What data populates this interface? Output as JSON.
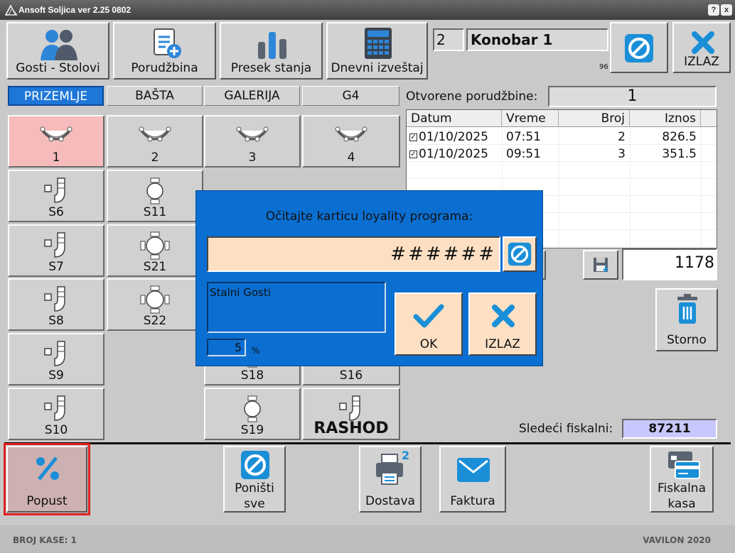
{
  "window": {
    "title": "Ansoft Soljica ver 2.25 0802",
    "help_label": "?",
    "close_label": "x"
  },
  "toolbar": {
    "guests_tables": "Gosti - Stolovi",
    "order": "Porudžbina",
    "state_cut": "Presek stanja",
    "daily_report": "Dnevni izveštaj"
  },
  "waiter": {
    "id": "2",
    "name": "Konobar 1",
    "small_number": "96"
  },
  "exit_label": "IZLAZ",
  "tabs": [
    "PRIZEMLJE",
    "BAŠTA",
    "GALERIJA",
    "G4"
  ],
  "tables": [
    {
      "label": "1",
      "icon": "round-table-icon",
      "selected": true
    },
    {
      "label": "2",
      "icon": "round-table-icon"
    },
    {
      "label": "3",
      "icon": "round-table-icon"
    },
    {
      "label": "4",
      "icon": "round-table-icon"
    },
    {
      "label": "S6",
      "icon": "bar-seat-icon"
    },
    {
      "label": "S11",
      "icon": "two-seat-table-icon"
    },
    {
      "label": "S7",
      "icon": "bar-seat-icon"
    },
    {
      "label": "S21",
      "icon": "four-seat-table-icon"
    },
    {
      "label": "S8",
      "icon": "bar-seat-icon"
    },
    {
      "label": "S22",
      "icon": "four-seat-table-icon"
    },
    {
      "label": "S9",
      "icon": "bar-seat-icon"
    },
    {
      "label": "S18",
      "icon": "two-seat-table-icon"
    },
    {
      "label": "S16",
      "icon": "bar-seat-icon"
    },
    {
      "label": "S10",
      "icon": "bar-seat-icon"
    },
    {
      "label": "S19",
      "icon": "two-seat-table-icon"
    },
    {
      "label": "RASHOD",
      "icon": "bar-seat-icon"
    }
  ],
  "orders": {
    "label": "Otvorene porudžbine:",
    "count": "1",
    "headers": [
      "Datum",
      "Vreme",
      "Broj",
      "Iznos"
    ],
    "rows": [
      {
        "date": "01/10/2025",
        "time": "07:51",
        "num": "2",
        "amount": "826.5"
      },
      {
        "date": "01/10/2025",
        "time": "09:51",
        "num": "3",
        "amount": "351.5"
      }
    ],
    "total": "1178"
  },
  "storno_label": "Storno",
  "fiscal": {
    "label": "Sledeći fiskalni:",
    "value": "87211"
  },
  "bottom_buttons": {
    "discount": "Popust",
    "cancel_all_1": "Poništi",
    "cancel_all_2": "sve",
    "delivery": "Dostava",
    "invoice": "Faktura",
    "fiscal_1": "Fiskalna",
    "fiscal_2": "kasa",
    "printer_badge": "2"
  },
  "dialog": {
    "title": "Očitajte karticu loyality programa:",
    "input_value": "######",
    "list_text": "Stalni Gosti",
    "percent_value": "5",
    "percent_label": "%",
    "ok_label": "OK",
    "exit_label": "IZLAZ"
  },
  "statusbar": {
    "left": "BROJ KASE: 1",
    "right": "VAVILON 2020"
  },
  "colors": {
    "accent_blue": "#1e77d8",
    "dialog_bg": "#0b6fd2",
    "selected_table": "#f6bcbc",
    "fiscal_bg": "#c8c8ff"
  }
}
